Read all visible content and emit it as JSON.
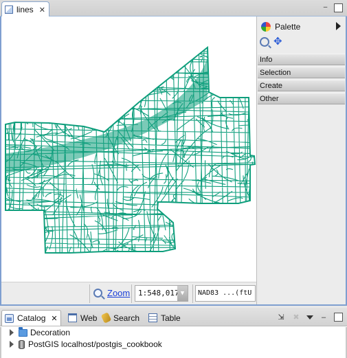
{
  "map_view": {
    "tab_label": "lines",
    "tab_close": "✕",
    "minimize": "–",
    "maximize": "□"
  },
  "status_bar": {
    "zoom_label": "Zoom",
    "scale_value": "1:548,017",
    "crs_label": "NAD83 ...(ftU"
  },
  "palette": {
    "title": "Palette",
    "drawers": [
      "Info",
      "Selection",
      "Create",
      "Other"
    ]
  },
  "bottom_panel": {
    "tabs": [
      {
        "label": "Catalog",
        "icon": "catalog-icon"
      },
      {
        "label": "Web",
        "icon": "web-icon"
      },
      {
        "label": "Search",
        "icon": "search-icon"
      },
      {
        "label": "Table",
        "icon": "table-icon"
      }
    ],
    "close": "✕",
    "tree": [
      {
        "label": "Decoration",
        "icon": "folder-icon"
      },
      {
        "label": "PostGIS localhost/postgis_cookbook",
        "icon": "database-icon"
      }
    ]
  },
  "colors": {
    "line_color": "#0e9e7c",
    "active_border": "#7f9fd0"
  }
}
